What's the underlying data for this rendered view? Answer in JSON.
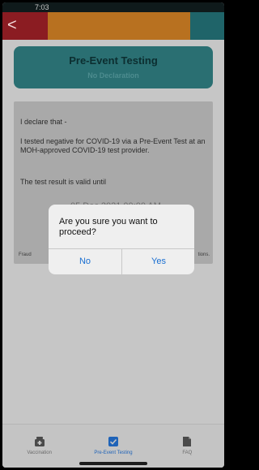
{
  "status": {
    "time": "7:03"
  },
  "header": {
    "back_icon": "chevron-left-icon",
    "back_symbol": "<"
  },
  "card": {
    "title": "Pre-Event Testing",
    "subtitle": "No Declaration"
  },
  "declaration": {
    "line1": "I declare that -",
    "line2": "I tested negative for COVID-19 via a Pre-Event Test at an MOH-approved COVID-19 test provider.",
    "line3": "The test result is valid until",
    "date_partial": "05 Dec 2021 00:00 AM",
    "footer_left": "Fraud",
    "footer_right": "tions."
  },
  "dialog": {
    "message": "Are you sure you want to proceed?",
    "no_label": "No",
    "yes_label": "Yes"
  },
  "tabs": [
    {
      "label": "Vaccination",
      "icon": "vaccination-icon"
    },
    {
      "label": "Pre-Event Testing",
      "icon": "checkbox-icon",
      "active": true
    },
    {
      "label": "FAQ",
      "icon": "faq-icon"
    }
  ],
  "colors": {
    "accent": "#1a6fd1",
    "header_red": "#8b1c22",
    "header_orange": "#b87120",
    "header_teal": "#1f6469",
    "card_teal": "#2a6f72"
  }
}
